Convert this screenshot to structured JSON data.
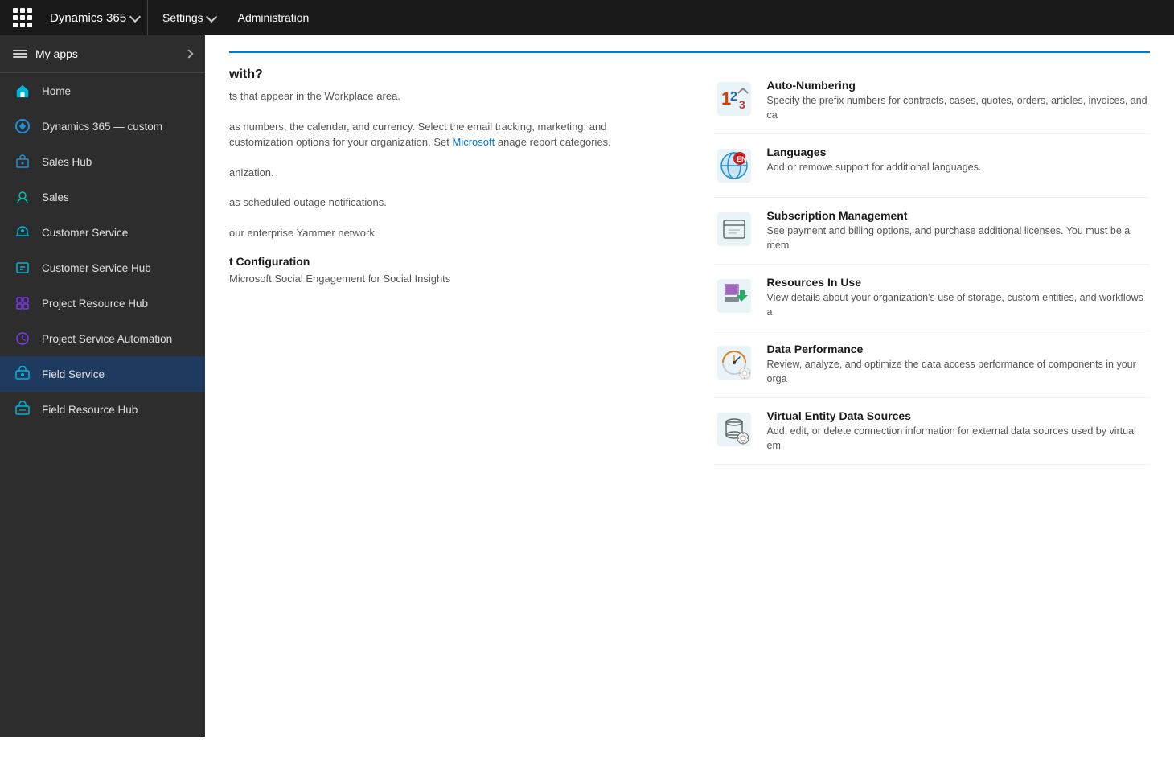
{
  "topbar": {
    "app_name": "Dynamics 365",
    "chevron": "▾",
    "nav_items": [
      {
        "label": "Settings",
        "has_chevron": true
      },
      {
        "label": "Administration",
        "has_chevron": false
      }
    ]
  },
  "sidebar": {
    "my_apps_label": "My apps",
    "items": [
      {
        "id": "home",
        "label": "Home",
        "icon": "home-icon"
      },
      {
        "id": "dynamics365custom",
        "label": "Dynamics 365 — custom",
        "icon": "dynamics-icon"
      },
      {
        "id": "saleshub",
        "label": "Sales Hub",
        "icon": "sales-hub-icon"
      },
      {
        "id": "sales",
        "label": "Sales",
        "icon": "sales-icon"
      },
      {
        "id": "customerservice",
        "label": "Customer Service",
        "icon": "customer-service-icon"
      },
      {
        "id": "customerservicehub",
        "label": "Customer Service Hub",
        "icon": "customer-service-hub-icon"
      },
      {
        "id": "projectresourcehub",
        "label": "Project Resource Hub",
        "icon": "project-resource-hub-icon"
      },
      {
        "id": "projectserviceautomation",
        "label": "Project Service Automation",
        "icon": "psa-icon"
      },
      {
        "id": "fieldservice",
        "label": "Field Service",
        "icon": "field-service-icon",
        "active": true
      },
      {
        "id": "fieldresourcehub",
        "label": "Field Resource Hub",
        "icon": "field-resource-hub-icon"
      }
    ],
    "more_label": "···"
  },
  "main": {
    "partial_heading": "with?",
    "section1_desc": "ts that appear in the Workplace area.",
    "divider": true,
    "section2_desc_part1": "as numbers, the calendar, and currency. Select the email tracking, marketing, and customization options for your organization. Set",
    "section2_link": "Microsoft",
    "section2_desc_part2": "anage report categories.",
    "section3_desc": "anization.",
    "section4_desc": "as scheduled outage notifications.",
    "section5_desc_part1": "our enterprise Yammer network",
    "section6_heading": "t Configuration",
    "section6_desc": "Microsoft Social Engagement for Social Insights",
    "cards": [
      {
        "id": "auto-numbering",
        "title": "Auto-Numbering",
        "description": "Specify the prefix numbers for contracts, cases, quotes, orders, articles, invoices, and ca",
        "icon": "auto-numbering-icon"
      },
      {
        "id": "languages",
        "title": "Languages",
        "description": "Add or remove support for additional languages.",
        "icon": "languages-icon"
      },
      {
        "id": "subscription-management",
        "title": "Subscription Management",
        "description": "See payment and billing options, and purchase additional licenses. You must be a mem",
        "icon": "subscription-management-icon"
      },
      {
        "id": "resources-in-use",
        "title": "Resources In Use",
        "description": "View details about your organization's use of storage, custom entities, and workflows a",
        "icon": "resources-in-use-icon"
      },
      {
        "id": "data-performance",
        "title": "Data Performance",
        "description": "Review, analyze, and optimize the data access performance of components in your orga",
        "icon": "data-performance-icon"
      },
      {
        "id": "virtual-entity-data-sources",
        "title": "Virtual Entity Data Sources",
        "description": "Add, edit, or delete connection information for external data sources used by virtual em",
        "icon": "virtual-entity-icon"
      }
    ]
  }
}
